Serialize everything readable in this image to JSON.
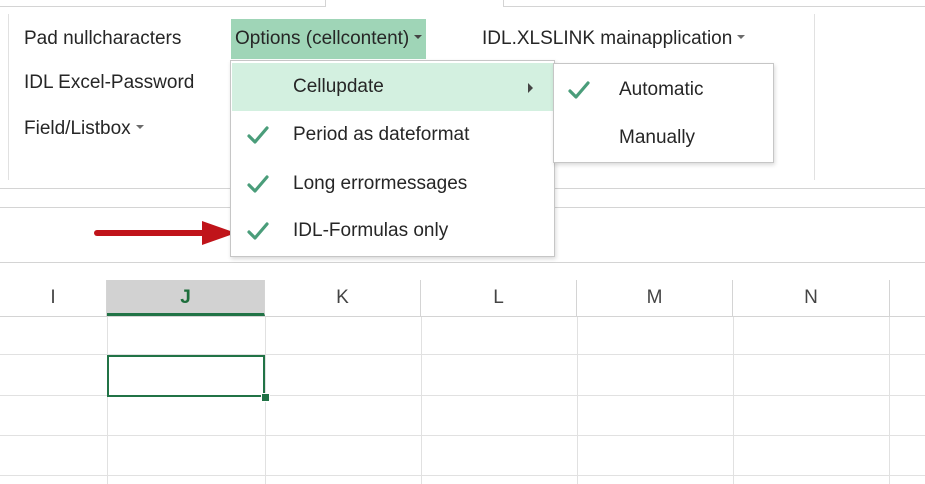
{
  "ribbon": {
    "pad_null": "Pad nullcharacters",
    "options": "Options (cellcontent)",
    "mainapp": "IDL.XLSLINK mainapplication",
    "excel_password": "IDL Excel-Password",
    "field_listbox": "Field/Listbox"
  },
  "menu": {
    "items": [
      {
        "label": "Cellupdate",
        "checked": false,
        "has_submenu": true,
        "highlighted": true
      },
      {
        "label": "Period as dateformat",
        "checked": true,
        "has_submenu": false,
        "highlighted": false
      },
      {
        "label": "Long errormessages",
        "checked": true,
        "has_submenu": false,
        "highlighted": false
      },
      {
        "label": "IDL-Formulas only",
        "checked": true,
        "has_submenu": false,
        "highlighted": false
      }
    ]
  },
  "submenu": {
    "items": [
      {
        "label": "Automatic",
        "checked": true
      },
      {
        "label": "Manually",
        "checked": false
      }
    ]
  },
  "grid": {
    "columns": [
      "I",
      "J",
      "K",
      "L",
      "M",
      "N"
    ],
    "selected_column": "J"
  },
  "colors": {
    "accent_green": "#217346",
    "check_green": "#4a9d7a",
    "menu_highlight": "#d3f0e0",
    "ribbon_active": "#9fd5b7",
    "arrow_red": "#c0141a"
  },
  "icons": {
    "check": "check-icon",
    "submenu_arrow": "chevron-right-icon",
    "dropdown_arrow": "caret-down-icon",
    "annotation_arrow": "arrow-right-icon"
  }
}
